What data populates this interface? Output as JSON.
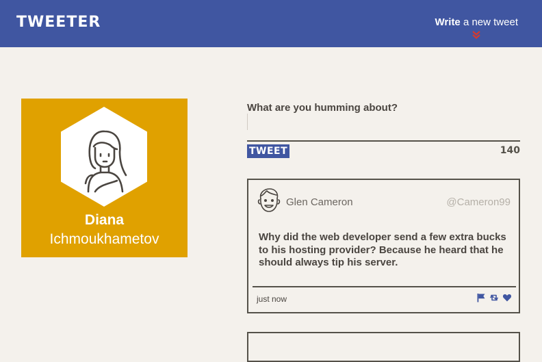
{
  "nav": {
    "brand": "TWEETER",
    "compose_bold": "Write",
    "compose_rest": " a new tweet",
    "chevron_icon": "double-chevron-down-icon",
    "accent": "#4056a1",
    "chevron_color": "#d43a2f"
  },
  "profile": {
    "first_name": "Diana",
    "last_name": "Ichmoukhametov",
    "card_color": "#e0a100",
    "avatar_icon": "woman-avatar-icon"
  },
  "compose": {
    "label": "What are you humming about?",
    "input_value": "",
    "input_placeholder": "",
    "submit_label": "TWEET",
    "counter": "140"
  },
  "tweets": [
    {
      "avatar_icon": "man-avatar-icon",
      "author": "Glen Cameron",
      "handle": "@Cameron99",
      "body": "Why did the web developer send a few extra bucks to his hosting provider? Because he heard that he should always tip his server.",
      "timestamp": "just now",
      "actions": [
        "flag-icon",
        "retweet-icon",
        "heart-icon"
      ]
    }
  ]
}
